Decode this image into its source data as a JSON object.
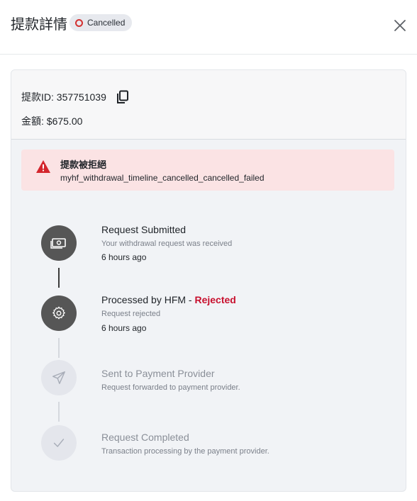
{
  "header": {
    "title": "提款詳情",
    "status_badge": "Cancelled",
    "close_icon": "close-icon"
  },
  "details": {
    "id_label": "提款ID: 357751039",
    "copy_icon": "copy-icon",
    "amount_label": "金額: $675.00"
  },
  "alert": {
    "icon": "warning-icon",
    "title": "提款被拒絕",
    "message": "myhf_withdrawal_timeline_cancelled_cancelled_failed"
  },
  "timeline": [
    {
      "title": "Request Submitted",
      "title_suffix": "",
      "description": "Your withdrawal request was received",
      "time": "6 hours ago",
      "icon": "money-icon",
      "state": "done"
    },
    {
      "title": "Processed by HFM - ",
      "title_suffix": "Rejected",
      "description": "Request rejected",
      "time": "6 hours ago",
      "icon": "gear-icon",
      "state": "done"
    },
    {
      "title": "Sent to Payment Provider",
      "title_suffix": "",
      "description": "Request forwarded to payment provider.",
      "time": "",
      "icon": "send-icon",
      "state": "pending"
    },
    {
      "title": "Request Completed",
      "title_suffix": "",
      "description": "Transaction processing by the payment provider.",
      "time": "",
      "icon": "check-icon",
      "state": "pending"
    }
  ],
  "colors": {
    "rejected": "#c8102e",
    "alert_bg": "#fbe3e4",
    "badge_ring": "#d33131",
    "active_circle": "#565656",
    "inactive_circle": "#e4e6ec"
  }
}
